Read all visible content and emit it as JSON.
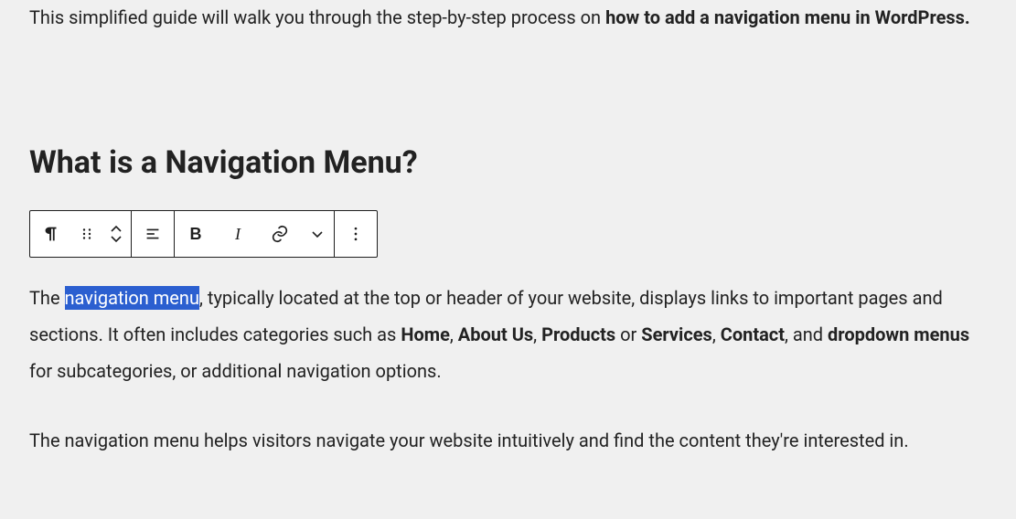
{
  "intro": {
    "plain": "This simplified guide will walk you through the step-by-step process on ",
    "strong": "how to add a navigation menu in WordPress."
  },
  "heading": "What is a Navigation Menu?",
  "toolbar": {
    "icons": {
      "paragraph": "paragraph-icon",
      "drag": "drag-icon",
      "moveup": "move-up-icon",
      "movedown": "move-down-icon",
      "align": "align-icon",
      "bold": "bold-icon",
      "italic": "italic-icon",
      "link": "link-icon",
      "more_format": "more-format-icon",
      "options": "options-icon"
    }
  },
  "para1": {
    "t1": "The ",
    "selected": "navigation menu",
    "t2": ", typically located at the top or header of your website, displays links to important pages and sections. It often includes categories such as ",
    "home": "Home",
    "c1": ", ",
    "about": "About Us",
    "c2": ", ",
    "products": "Products",
    "or": " or ",
    "services": "Services",
    "c3": ", ",
    "contact": "Contact",
    "c4": ", and ",
    "dropdown": "dropdown menus",
    "t3": " for subcategories, or additional navigation options."
  },
  "para2": "The navigation menu helps visitors navigate your website intuitively and find the content they're interested in."
}
